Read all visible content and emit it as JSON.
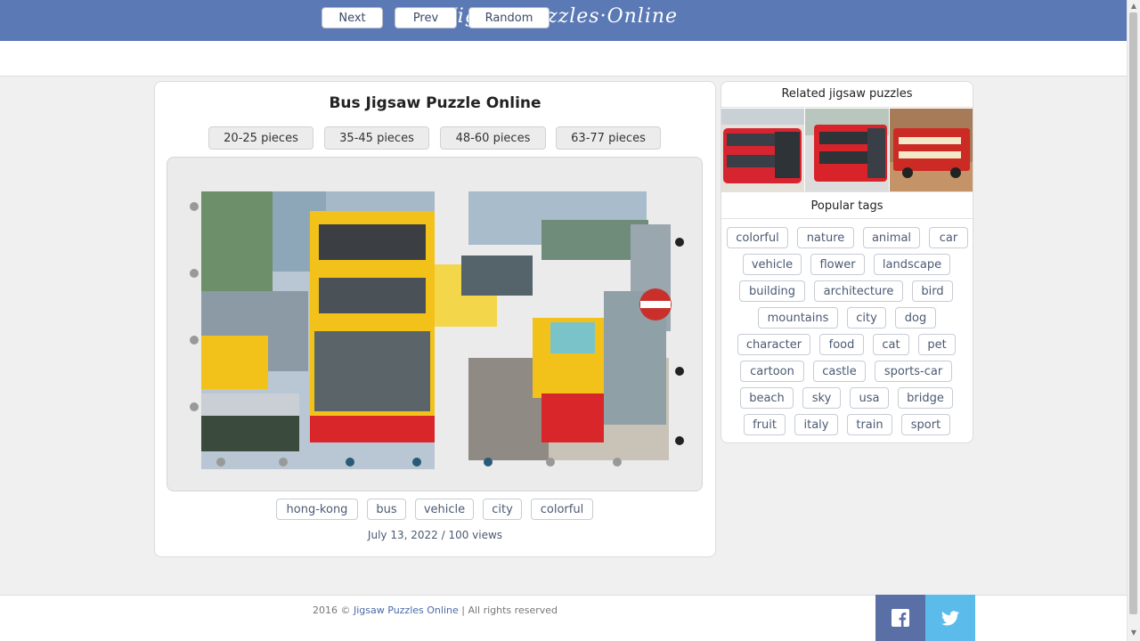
{
  "site": {
    "logo": "JigsawPuzzles·Online"
  },
  "nav": {
    "next": "Next",
    "prev": "Prev",
    "random": "Random"
  },
  "puzzle": {
    "title": "Bus Jigsaw Puzzle Online",
    "piece_options": [
      "20-25 pieces",
      "35-45 pieces",
      "48-60 pieces",
      "63-77 pieces"
    ],
    "tags": [
      "hong-kong",
      "bus",
      "vehicle",
      "city",
      "colorful"
    ],
    "date": "July 13, 2022",
    "views": "100 views"
  },
  "sidebar": {
    "related_title": "Related jigsaw puzzles",
    "popular_title": "Popular tags",
    "popular_tags": [
      "colorful",
      "nature",
      "animal",
      "car",
      "vehicle",
      "flower",
      "landscape",
      "building",
      "architecture",
      "bird",
      "mountains",
      "city",
      "dog",
      "character",
      "food",
      "cat",
      "pet",
      "cartoon",
      "castle",
      "sports-car",
      "beach",
      "sky",
      "usa",
      "bridge",
      "fruit",
      "italy",
      "train",
      "sport"
    ]
  },
  "footer": {
    "year": "2016 ©",
    "site_link": "Jigsaw Puzzles Online",
    "rights": "| All rights reserved"
  },
  "colors": {
    "header": "#5b7ab5",
    "facebook": "#5b6fa7",
    "twitter": "#5bbcec",
    "bus_yellow": "#f2c21b",
    "bus_red": "#d9262b"
  },
  "icons": {
    "facebook": "facebook-icon",
    "twitter": "twitter-icon"
  }
}
